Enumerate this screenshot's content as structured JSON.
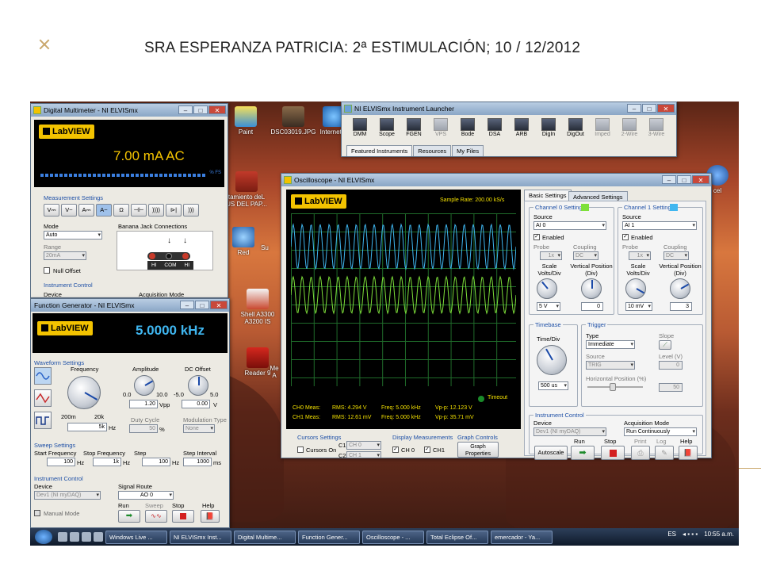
{
  "slide": {
    "title": "SRA ESPERANZA PATRICIA: 2ª ESTIMULACIÓN; 10 / 12/2012"
  },
  "desktop": {
    "icons": [
      {
        "label": "Paint"
      },
      {
        "label": "DSC03019.JPG"
      },
      {
        "label": "Internet E"
      },
      {
        "label": "tamiento deL\nUS DEL PAP..."
      },
      {
        "label": "Red"
      },
      {
        "label": "Su"
      },
      {
        "label": "Shell A3300\nA3200 IS"
      },
      {
        "label": "Reader 9"
      },
      {
        "label": "Me\nA"
      },
      {
        "label": "cel"
      }
    ]
  },
  "dmm": {
    "title": "Digital Multimeter - NI ELVISmx",
    "reading": "7.00 mA AC",
    "bar_unit": "% FS",
    "measurement_settings": "Measurement Settings",
    "modes": [
      "V⎓",
      "V~",
      "A⎓",
      "A~",
      "Ω",
      "⊣⊢",
      "))))",
      "⊳|",
      ")))"
    ],
    "mode_label": "Mode",
    "mode_value": "Auto",
    "range_label": "Range",
    "range_value": "20mA",
    "null_offset": "Null Offset",
    "banana_label": "Banana Jack Connections",
    "jacks": [
      "HI",
      "COM",
      "HI"
    ],
    "instrument_control": "Instrument Control",
    "device": "Device",
    "acquisition_mode": "Acquisition Mode"
  },
  "fgen": {
    "title": "Function Generator - NI ELVISmx",
    "frequency_display": "5.0000 kHz",
    "waveform_settings": "Waveform Settings",
    "frequency_label": "Frequency",
    "freq_min": "200m",
    "freq_max": "20k",
    "freq_value": "5k",
    "freq_unit": "Hz",
    "amplitude_label": "Amplitude",
    "amp_min": "0.0",
    "amp_max": "10.0",
    "amp_value": "1.20",
    "amp_unit": "Vpp",
    "dc_label": "DC Offset",
    "dc_min": "-5.0",
    "dc_max": "5.0",
    "dc_value": "0.00",
    "dc_unit": "V",
    "duty_label": "Duty Cycle",
    "duty_value": "50",
    "duty_unit": "%",
    "mod_label": "Modulation Type",
    "mod_value": "None",
    "sweep_settings": "Sweep Settings",
    "start_freq_label": "Start Frequency",
    "start_freq": "100",
    "stop_freq_label": "Stop Frequency",
    "stop_freq": "1k",
    "step_label": "Step",
    "step": "100",
    "interval_label": "Step Interval",
    "interval": "1000",
    "hz": "Hz",
    "ms": "ms",
    "instrument_control": "Instrument Control",
    "device_label": "Device",
    "device": "Dev1 (NI myDAQ)",
    "signal_route_label": "Signal Route",
    "signal_route": "AO 0",
    "manual_mode": "Manual Mode",
    "buttons": {
      "run": "Run",
      "sweep": "Sweep",
      "stop": "Stop",
      "help": "Help"
    }
  },
  "launcher": {
    "title": "NI ELVISmx Instrument Launcher",
    "items": [
      {
        "label": "DMM",
        "enabled": true
      },
      {
        "label": "Scope",
        "enabled": true
      },
      {
        "label": "FGEN",
        "enabled": true
      },
      {
        "label": "VPS",
        "enabled": false
      },
      {
        "label": "Bode",
        "enabled": true
      },
      {
        "label": "DSA",
        "enabled": true
      },
      {
        "label": "ARB",
        "enabled": true
      },
      {
        "label": "DigIn",
        "enabled": true
      },
      {
        "label": "DigOut",
        "enabled": true
      },
      {
        "label": "Imped",
        "enabled": false
      },
      {
        "label": "2-Wire",
        "enabled": false
      },
      {
        "label": "3-Wire",
        "enabled": false
      }
    ],
    "tabs": [
      "Featured Instruments",
      "Resources",
      "My Files"
    ]
  },
  "scope": {
    "title": "Oscilloscope - NI ELVISmx",
    "sample_rate": "Sample Rate:  200.00 kS/s",
    "timeout": "Timeout",
    "ch0_meas": {
      "label": "CH0 Meas:",
      "rms": "RMS:  4.294 V",
      "freq": "Freq:  5.000 kHz",
      "vpp": "Vp-p:  12.123 V"
    },
    "ch1_meas": {
      "label": "CH1 Meas:",
      "rms": "RMS:  12.61 mV",
      "freq": "Freq:  5.000 kHz",
      "vpp": "Vp-p:  35.71 mV"
    },
    "cursors_settings": "Cursors Settings",
    "cursors_on": "Cursors On",
    "c1_label": "C1",
    "c1": "CH 0",
    "c2_label": "C2",
    "c2": "CH 1",
    "display_measurements": "Display Measurements",
    "dm_ch0": "CH 0",
    "dm_ch1": "CH1",
    "graph_controls": "Graph Controls",
    "graph_properties": "Graph Properties",
    "tabs": [
      "Basic Settings",
      "Advanced Settings"
    ],
    "ch0": {
      "heading": "Channel 0 Settings",
      "color": "#7ee03a",
      "source_label": "Source",
      "source": "AI 0",
      "enabled": "Enabled",
      "probe_label": "Probe",
      "probe": "1x",
      "coupling_label": "Coupling",
      "coupling": "DC",
      "scale_label": "Scale Volts/Div",
      "scale": "5 V",
      "vpos_label": "Vertical Position (Div)",
      "vpos": "0"
    },
    "ch1": {
      "heading": "Channel 1 Settings",
      "color": "#3fb6f0",
      "source_label": "Source",
      "source": "AI 1",
      "enabled": "Enabled",
      "probe_label": "Probe",
      "probe": "1x",
      "coupling_label": "Coupling",
      "coupling": "DC",
      "scale_label": "Scale Volts/Div",
      "scale": "10 mV",
      "vpos_label": "Vertical Position (Div)",
      "vpos": "3"
    },
    "timebase": "Timebase",
    "time_div_label": "Time/Div",
    "time_div": "500 us",
    "trigger": "Trigger",
    "type_label": "Type",
    "type": "Immediate",
    "slope_label": "Slope",
    "source_label": "Source",
    "trig_source": "TRIG",
    "level_label": "Level (V)",
    "level": "0",
    "hpos_label": "Horizontal Position (%)",
    "hpos": "50",
    "instrument_control": "Instrument Control",
    "device_label": "Device",
    "device": "Dev1 (NI myDAQ)",
    "acq_label": "Acquisition Mode",
    "acq": "Run Continuously",
    "autoscale": "Autoscale",
    "buttons": {
      "run": "Run",
      "stop": "Stop",
      "print": "Print",
      "log": "Log",
      "help": "Help"
    }
  },
  "taskbar": {
    "items": [
      "Windows Live ...",
      "NI ELVISmx Inst...",
      "Digital Multime...",
      "Function Gener...",
      "Oscilloscope - ...",
      "Total Eclipse Of...",
      "emercador - Ya..."
    ],
    "lang": "ES",
    "clock": "10:55 a.m."
  }
}
